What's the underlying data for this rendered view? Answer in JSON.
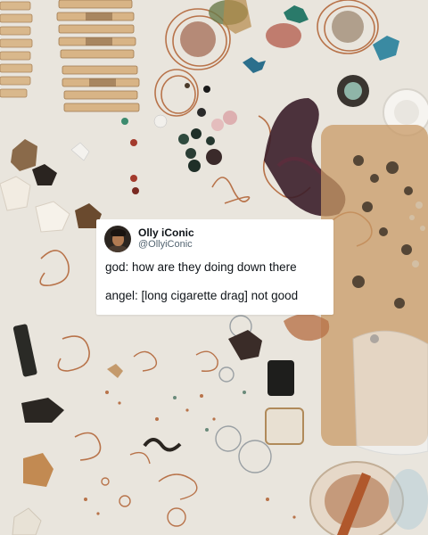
{
  "post": {
    "display_name": "Olly iConic",
    "handle": "@OllyiConic",
    "lines": [
      "god: how are they doing down there",
      "angel: [long cigarette drag] not good"
    ]
  },
  "photo": {
    "description_icon": "craft-table-photo"
  },
  "colors": {
    "table": "#ece8e1",
    "wood": "#d9b88c",
    "copper": "#b8734a",
    "card": "#ffffff",
    "text": "#0f1419",
    "muted": "#536471"
  }
}
